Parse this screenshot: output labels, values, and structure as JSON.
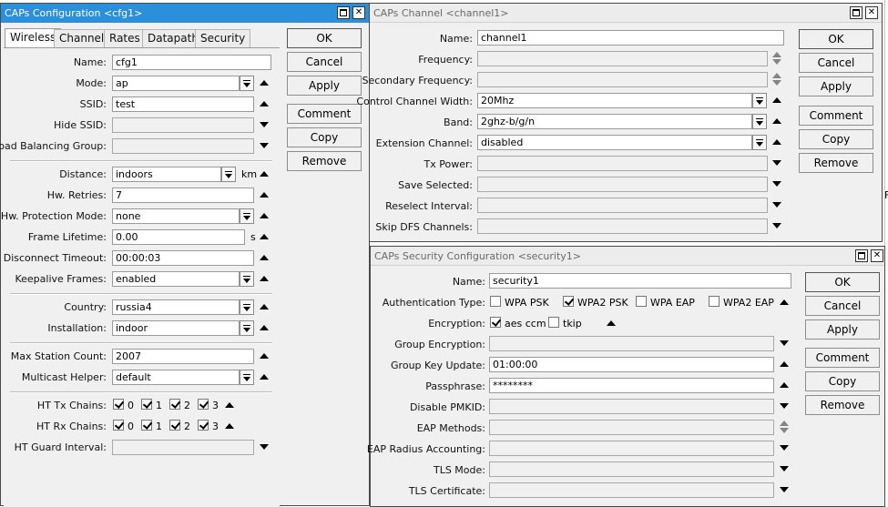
{
  "cfg_window": {
    "title": "CAPs Configuration <cfg1>",
    "tabs": [
      "Wireless",
      "Channel",
      "Rates",
      "Datapath",
      "Security"
    ],
    "fields": {
      "name": {
        "label": "Name:",
        "value": "cfg1"
      },
      "mode": {
        "label": "Mode:",
        "value": "ap"
      },
      "ssid": {
        "label": "SSID:",
        "value": "test"
      },
      "hide_ssid": {
        "label": "Hide SSID:",
        "value": ""
      },
      "load_balancing": {
        "label": "Load Balancing Group:",
        "value": ""
      },
      "distance": {
        "label": "Distance:",
        "value": "indoors",
        "unit": "km"
      },
      "hw_retries": {
        "label": "Hw. Retries:",
        "value": "7"
      },
      "hw_protection": {
        "label": "Hw. Protection Mode:",
        "value": "none"
      },
      "frame_lifetime": {
        "label": "Frame Lifetime:",
        "value": "0.00",
        "unit": "s"
      },
      "disconnect_timeout": {
        "label": "Disconnect Timeout:",
        "value": "00:00:03"
      },
      "keepalive": {
        "label": "Keepalive Frames:",
        "value": "enabled"
      },
      "country": {
        "label": "Country:",
        "value": "russia4"
      },
      "installation": {
        "label": "Installation:",
        "value": "indoor"
      },
      "max_station": {
        "label": "Max Station Count:",
        "value": "2007"
      },
      "multicast_helper": {
        "label": "Multicast Helper:",
        "value": "default"
      },
      "ht_tx": {
        "label": "HT Tx Chains:",
        "chains": [
          "0",
          "1",
          "2",
          "3"
        ]
      },
      "ht_rx": {
        "label": "HT Rx Chains:",
        "chains": [
          "0",
          "1",
          "2",
          "3"
        ]
      },
      "ht_guard": {
        "label": "HT Guard Interval:",
        "value": ""
      }
    },
    "buttons": {
      "ok": "OK",
      "cancel": "Cancel",
      "apply": "Apply",
      "comment": "Comment",
      "copy": "Copy",
      "remove": "Remove"
    }
  },
  "channel_window": {
    "title": "CAPs Channel <channel1>",
    "fields": {
      "name": {
        "label": "Name:",
        "value": "channel1"
      },
      "frequency": {
        "label": "Frequency:",
        "value": ""
      },
      "secondary_frequency": {
        "label": "Secondary Frequency:",
        "value": ""
      },
      "control_width": {
        "label": "Control Channel Width:",
        "value": "20Mhz"
      },
      "band": {
        "label": "Band:",
        "value": "2ghz-b/g/n"
      },
      "extension_channel": {
        "label": "Extension Channel:",
        "value": "disabled"
      },
      "tx_power": {
        "label": "Tx Power:",
        "value": ""
      },
      "save_selected": {
        "label": "Save Selected:",
        "value": ""
      },
      "reselect_interval": {
        "label": "Reselect Interval:",
        "value": ""
      },
      "skip_dfs": {
        "label": "Skip DFS Channels:",
        "value": ""
      }
    },
    "buttons": {
      "ok": "OK",
      "cancel": "Cancel",
      "apply": "Apply",
      "comment": "Comment",
      "copy": "Copy",
      "remove": "Remove"
    }
  },
  "security_window": {
    "title": "CAPs Security Configuration <security1>",
    "fields": {
      "name": {
        "label": "Name:",
        "value": "security1"
      },
      "auth_type": {
        "label": "Authentication Type:",
        "options": [
          "WPA PSK",
          "WPA2 PSK",
          "WPA EAP",
          "WPA2 EAP"
        ]
      },
      "encryption": {
        "label": "Encryption:",
        "options": [
          "aes ccm",
          "tkip"
        ]
      },
      "group_encryption": {
        "label": "Group Encryption:",
        "value": ""
      },
      "group_key_update": {
        "label": "Group Key Update:",
        "value": "01:00:00"
      },
      "passphrase": {
        "label": "Passphrase:",
        "value": "********"
      },
      "disable_pmkid": {
        "label": "Disable PMKID:",
        "value": ""
      },
      "eap_methods": {
        "label": "EAP Methods:",
        "value": ""
      },
      "eap_radius": {
        "label": "EAP Radius Accounting:",
        "value": ""
      },
      "tls_mode": {
        "label": "TLS Mode:",
        "value": ""
      },
      "tls_certificate": {
        "label": "TLS Certificate:",
        "value": ""
      }
    },
    "buttons": {
      "ok": "OK",
      "cancel": "Cancel",
      "apply": "Apply",
      "comment": "Comment",
      "copy": "Copy",
      "remove": "Remove"
    }
  },
  "background": {
    "right_edge_text": "F"
  }
}
